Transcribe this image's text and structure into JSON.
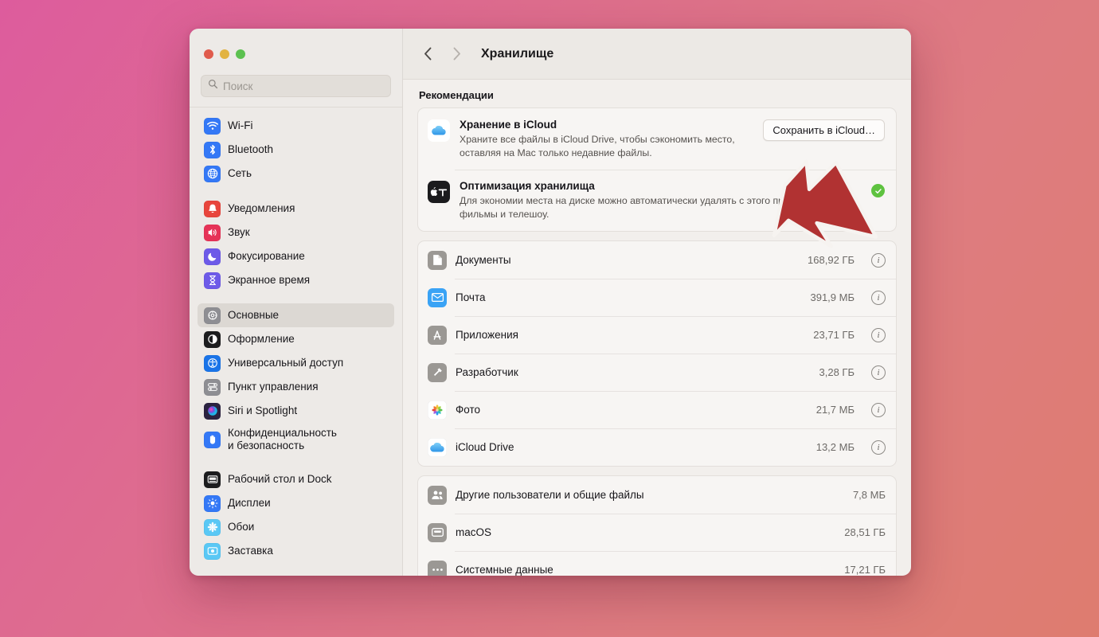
{
  "window": {
    "traffic_lights": [
      "close",
      "minimize",
      "zoom"
    ],
    "accent_red": "#b03232",
    "green_check": "#5ec23f"
  },
  "search": {
    "placeholder": "Поиск",
    "value": "",
    "icon": "search-icon"
  },
  "sidebar": {
    "groups": [
      {
        "items": [
          {
            "label": "Wi-Fi",
            "icon": "wifi-icon",
            "color": "#3478f6",
            "active": false
          },
          {
            "label": "Bluetooth",
            "icon": "bluetooth-icon",
            "color": "#3478f6",
            "active": false
          },
          {
            "label": "Сеть",
            "icon": "globe-icon",
            "color": "#3478f6",
            "active": false
          }
        ]
      },
      {
        "items": [
          {
            "label": "Уведомления",
            "icon": "bell-icon",
            "color": "#e8453c",
            "active": false
          },
          {
            "label": "Звук",
            "icon": "speaker-icon",
            "color": "#e63357",
            "active": false
          },
          {
            "label": "Фокусирование",
            "icon": "moon-icon",
            "color": "#6d5ae8",
            "active": false
          },
          {
            "label": "Экранное время",
            "icon": "hourglass-icon",
            "color": "#6d5ae8",
            "active": false
          }
        ]
      },
      {
        "items": [
          {
            "label": "Основные",
            "icon": "gear-icon",
            "color": "#8e8e93",
            "active": true
          },
          {
            "label": "Оформление",
            "icon": "appearance-icon",
            "color": "#1c1c1e",
            "active": false
          },
          {
            "label": "Универсальный доступ",
            "icon": "accessibility-icon",
            "color": "#1a74e8",
            "active": false
          },
          {
            "label": "Пункт управления",
            "icon": "control-center-icon",
            "color": "#8e8e93",
            "active": false
          },
          {
            "label": "Siri и Spotlight",
            "icon": "siri-icon",
            "color": "#2b2240",
            "active": false
          },
          {
            "label": "Конфиденциальность и безопасность",
            "icon": "privacy-hand-icon",
            "color": "#3478f6",
            "active": false,
            "two_line": true,
            "line1": "Конфиденциальность",
            "line2": "и безопасность"
          }
        ]
      },
      {
        "items": [
          {
            "label": "Рабочий стол и Dock",
            "icon": "desktop-dock-icon",
            "color": "#1c1c1e",
            "active": false
          },
          {
            "label": "Дисплеи",
            "icon": "display-icon",
            "color": "#3478f6",
            "active": false
          },
          {
            "label": "Обои",
            "icon": "wallpaper-icon",
            "color": "#5ac8f5",
            "active": false
          },
          {
            "label": "Заставка",
            "icon": "screensaver-icon",
            "color": "#5ac8f5",
            "active": false
          }
        ]
      }
    ]
  },
  "toolbar": {
    "back_icon": "chevron-left-icon",
    "forward_icon": "chevron-right-icon",
    "title": "Хранилище"
  },
  "main": {
    "recommendations_heading": "Рекомендации",
    "recommendations": [
      {
        "title": "Хранение в iCloud",
        "desc": "Храните все файлы в iCloud Drive, чтобы сэкономить место, оставляя на Mac только недавние файлы.",
        "icon": "icloud-icon",
        "action_type": "button",
        "action_label": "Сохранить в iCloud…"
      },
      {
        "title": "Оптимизация хранилища",
        "desc": "Для экономии места на диске можно автоматически удалять с этого просмотренные фильмы и телешоу.",
        "icon": "apple-tv-icon",
        "action_type": "check",
        "action_label": "Включено"
      }
    ],
    "storage_groups": [
      {
        "rows": [
          {
            "name": "Документы",
            "size": "168,92 ГБ",
            "icon": "document-icon",
            "color": "#9b9894",
            "has_info": true
          },
          {
            "name": "Почта",
            "size": "391,9 МБ",
            "icon": "mail-icon",
            "color": "#3aa3f5",
            "has_info": true
          },
          {
            "name": "Приложения",
            "size": "23,71 ГБ",
            "icon": "app-store-icon",
            "color": "#9b9894",
            "has_info": true
          },
          {
            "name": "Разработчик",
            "size": "3,28 ГБ",
            "icon": "hammer-icon",
            "color": "#9b9894",
            "has_info": true
          },
          {
            "name": "Фото",
            "size": "21,7 МБ",
            "icon": "photos-icon",
            "color": "#ffffff",
            "has_info": true
          },
          {
            "name": "iCloud Drive",
            "size": "13,2 МБ",
            "icon": "icloud-icon",
            "color": "#ffffff",
            "has_info": true
          }
        ]
      },
      {
        "rows": [
          {
            "name": "Другие пользователи и общие файлы",
            "size": "7,8 МБ",
            "icon": "users-icon",
            "color": "#9b9894",
            "has_info": false
          },
          {
            "name": "macOS",
            "size": "28,51 ГБ",
            "icon": "macos-icon",
            "color": "#9b9894",
            "has_info": false
          },
          {
            "name": "Системные данные",
            "size": "17,21 ГБ",
            "icon": "system-data-icon",
            "color": "#9b9894",
            "has_info": false
          }
        ]
      }
    ]
  },
  "annotation": {
    "arrow": "red-arrow-pointing-down-right",
    "color": "#b13232"
  }
}
